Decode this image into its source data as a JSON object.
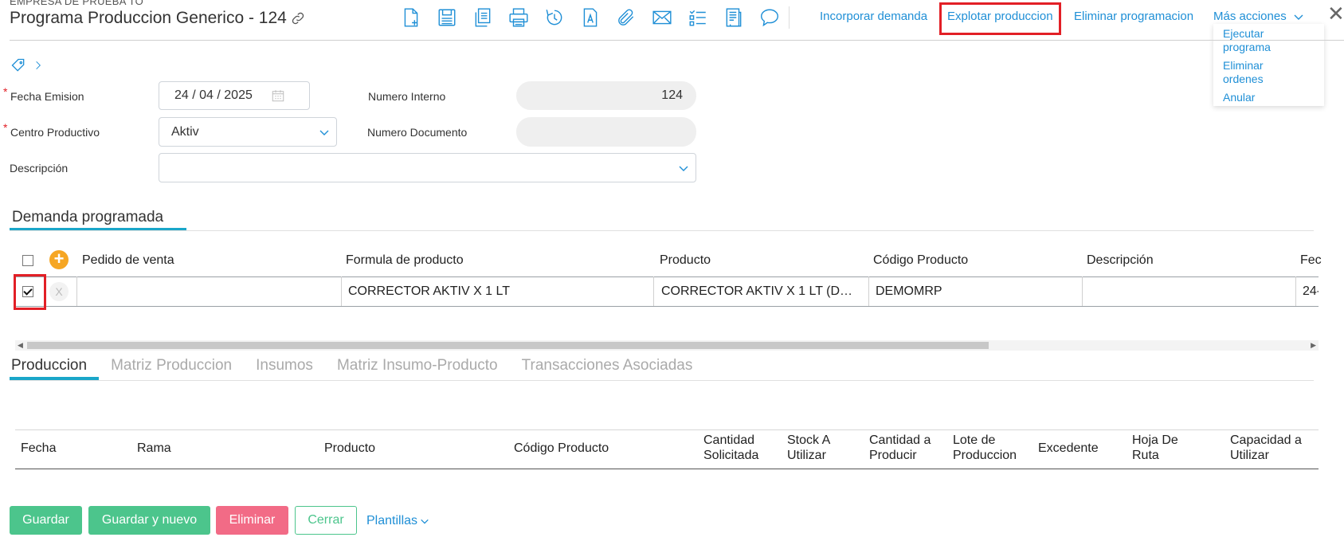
{
  "header": {
    "company": "EMPRESA DE PRUEBA TO",
    "title": "Programa Produccion Generico - 124"
  },
  "toolbar": {
    "icons": [
      "new-document-icon",
      "save-icon",
      "copy-icon",
      "print-icon",
      "history-icon",
      "text-document-icon",
      "attachment-icon",
      "email-icon",
      "checklist-icon",
      "report-icon",
      "comment-icon"
    ],
    "links": {
      "incorporar": "Incorporar demanda",
      "explotar": "Explotar produccion",
      "eliminar_programacion": "Eliminar programacion",
      "mas_acciones": "Más acciones"
    },
    "menu": {
      "ejecutar": "Ejecutar programa",
      "eliminar_ordenes": "Eliminar ordenes",
      "anular": "Anular"
    }
  },
  "form": {
    "fecha_label": "Fecha Emision",
    "fecha_value": "24 / 04 / 2025",
    "numero_interno_label": "Numero Interno",
    "numero_interno_value": "124",
    "centro_label": "Centro Productivo",
    "centro_value": "Aktiv",
    "numero_documento_label": "Numero Documento",
    "numero_documento_value": "",
    "descripcion_label": "Descripción",
    "descripcion_value": ""
  },
  "demanda": {
    "title": "Demanda programada",
    "columns": {
      "pedido": "Pedido de venta",
      "formula": "Formula de producto",
      "producto": "Producto",
      "codigo": "Código Producto",
      "descripcion": "Descripción",
      "fecha": "Fec"
    },
    "row": {
      "remove": "X",
      "pedido": "",
      "formula": "CORRECTOR AKTIV X 1 LT",
      "producto": "CORRECTOR AKTIV X 1 LT (D…",
      "codigo": "DEMOMRP",
      "descripcion": "",
      "fecha": "24-"
    }
  },
  "tabs": {
    "produccion": "Produccion",
    "matriz_produccion": "Matriz Produccion",
    "insumos": "Insumos",
    "matriz_insumo": "Matriz Insumo-Producto",
    "transacciones": "Transacciones Asociadas"
  },
  "produccion_grid": {
    "fecha": "Fecha",
    "rama": "Rama",
    "producto": "Producto",
    "codigo": "Código Producto",
    "cantidad_solicitada_1": "Cantidad",
    "cantidad_solicitada_2": "Solicitada",
    "stock_1": "Stock A",
    "stock_2": "Utilizar",
    "cantidad_producir_1": "Cantidad a",
    "cantidad_producir_2": "Producir",
    "lote_1": "Lote de",
    "lote_2": "Produccion",
    "excedente": "Excedente",
    "hoja_1": "Hoja De",
    "hoja_2": "Ruta",
    "capacidad_1": "Capacidad a",
    "capacidad_2": "Utilizar"
  },
  "footer": {
    "guardar": "Guardar",
    "guardar_nuevo": "Guardar y nuevo",
    "eliminar": "Eliminar",
    "cerrar": "Cerrar",
    "plantillas": "Plantillas"
  }
}
